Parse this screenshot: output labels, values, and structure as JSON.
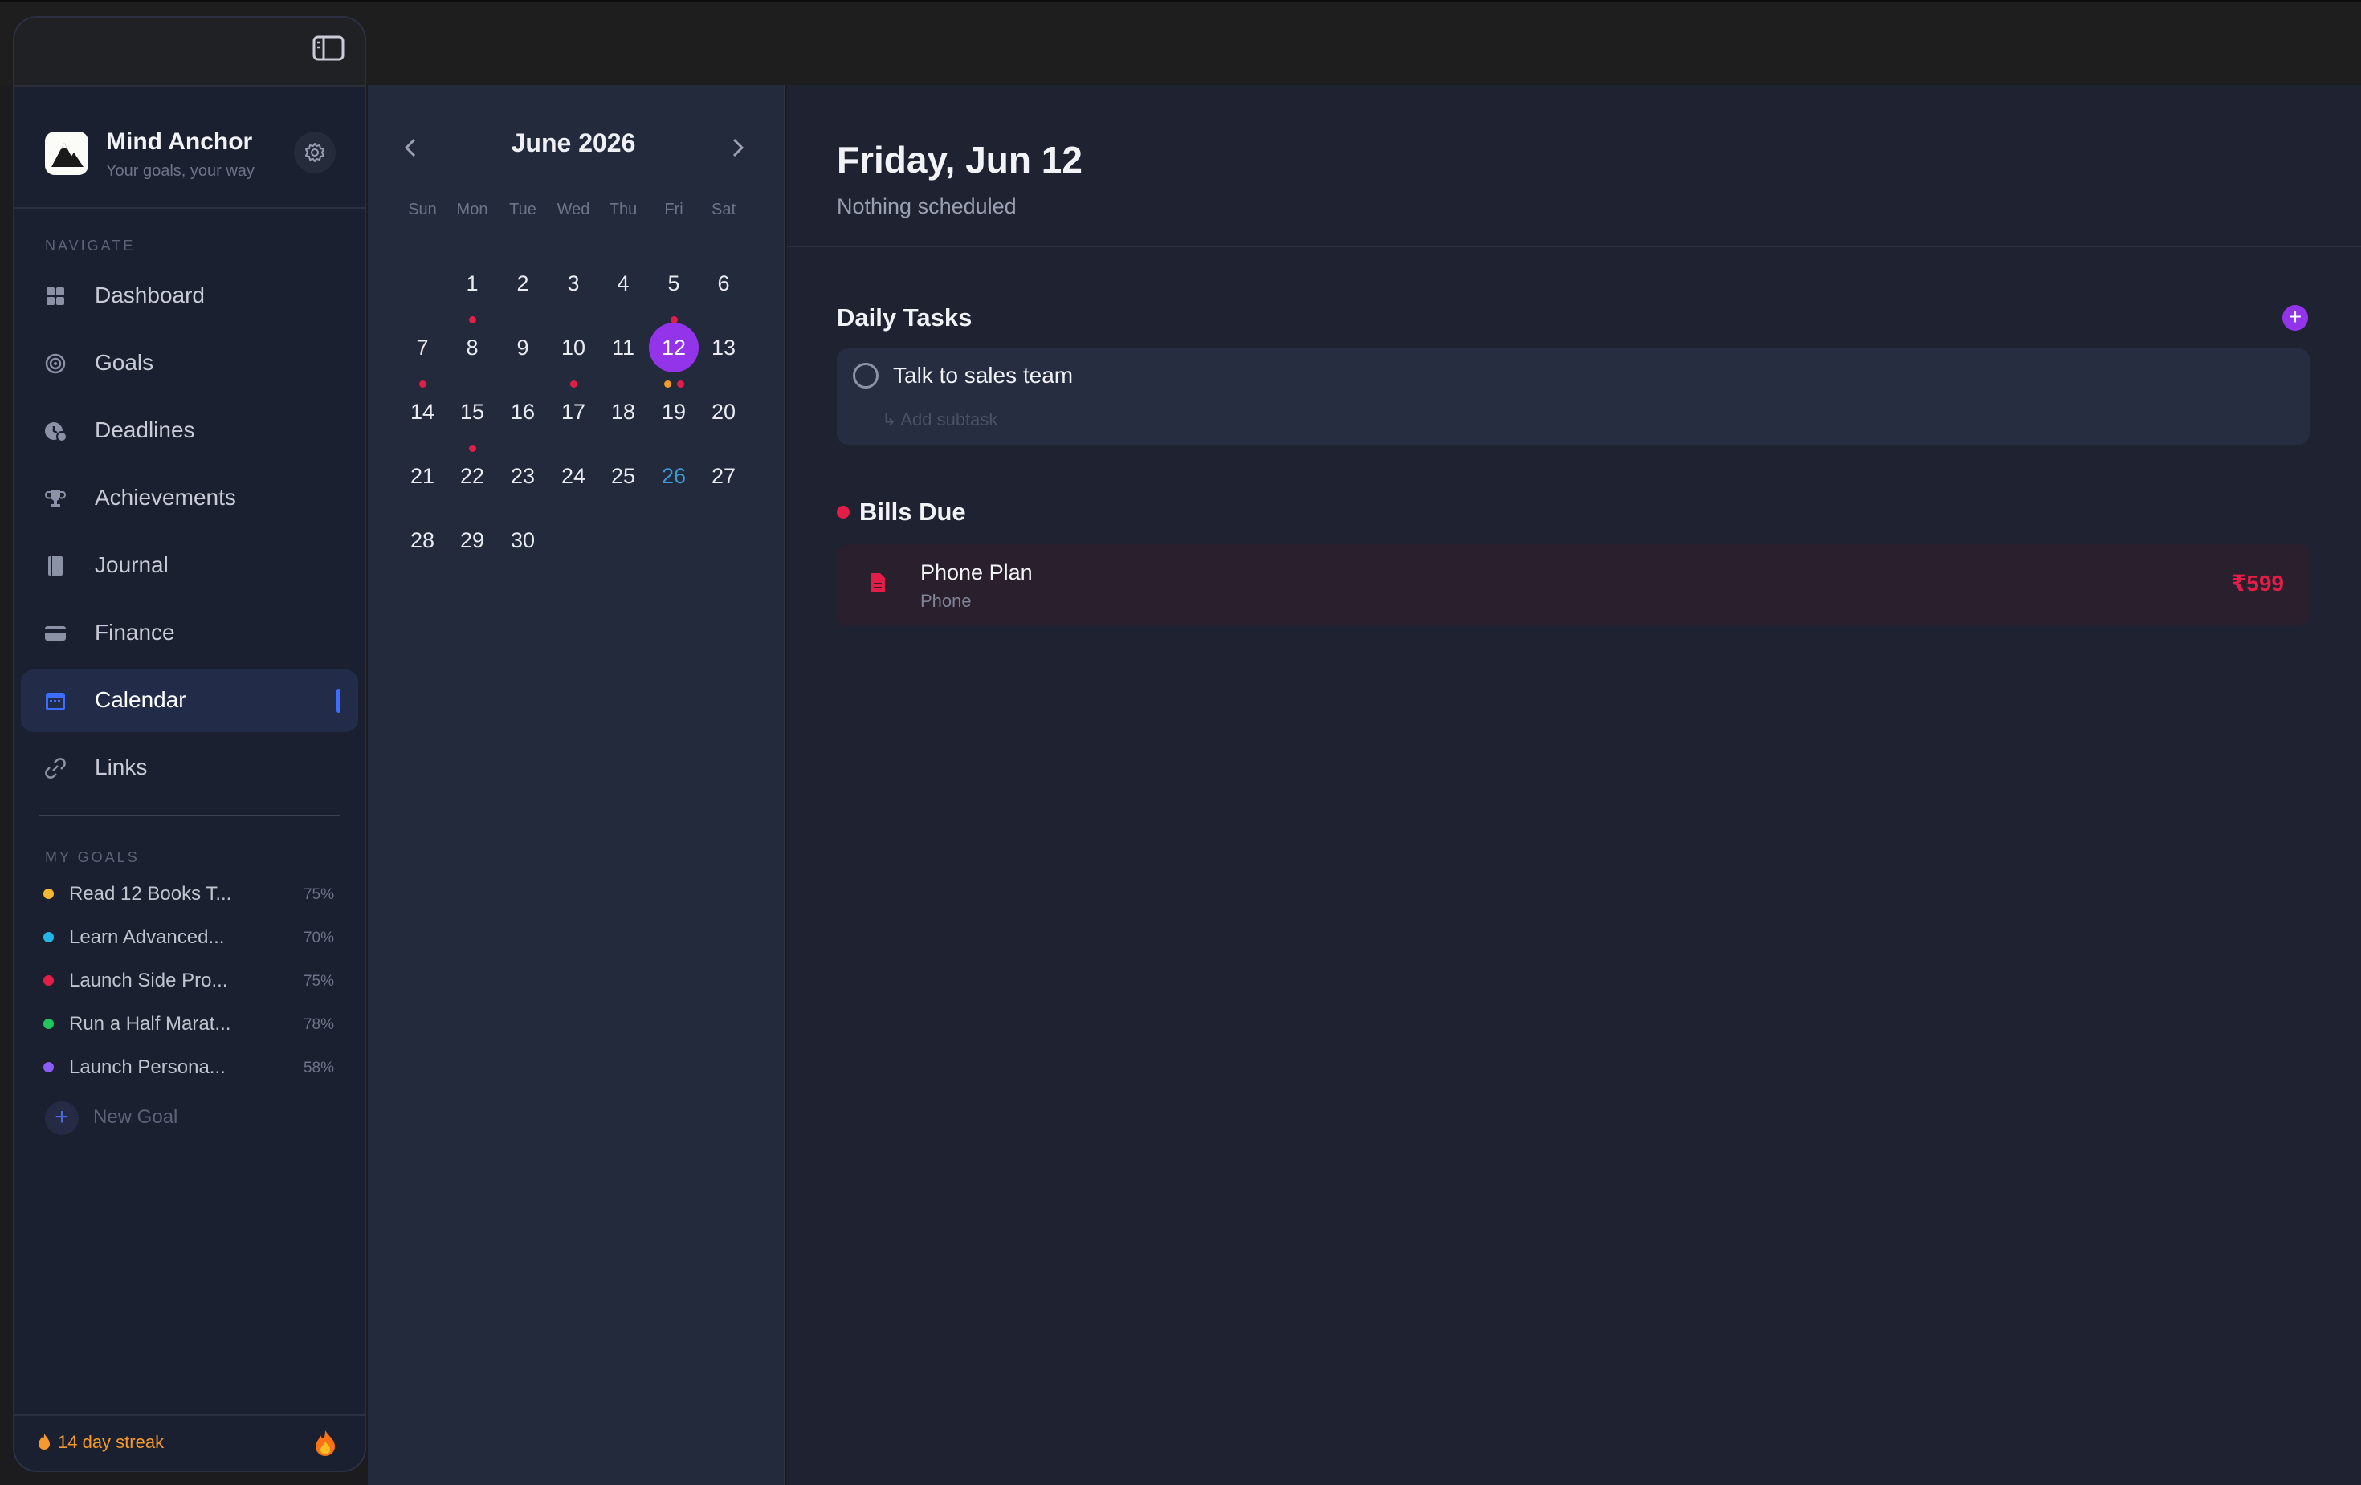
{
  "brand": {
    "name": "Mind Anchor",
    "tagline": "Your goals, your way"
  },
  "nav": {
    "section_label": "NAVIGATE",
    "items": [
      {
        "label": "Dashboard",
        "icon": "grid-icon"
      },
      {
        "label": "Goals",
        "icon": "target-icon"
      },
      {
        "label": "Deadlines",
        "icon": "clock-alert-icon"
      },
      {
        "label": "Achievements",
        "icon": "trophy-icon"
      },
      {
        "label": "Journal",
        "icon": "book-icon"
      },
      {
        "label": "Finance",
        "icon": "card-icon"
      },
      {
        "label": "Calendar",
        "icon": "calendar-icon",
        "active": true
      },
      {
        "label": "Links",
        "icon": "link-icon"
      }
    ]
  },
  "goals": {
    "section_label": "MY GOALS",
    "items": [
      {
        "label": "Read 12 Books T...",
        "pct": "75%",
        "color": "#f5b82e"
      },
      {
        "label": "Learn Advanced...",
        "pct": "70%",
        "color": "#22b8e6"
      },
      {
        "label": "Launch Side Pro...",
        "pct": "75%",
        "color": "#e11d48"
      },
      {
        "label": "Run a Half Marat...",
        "pct": "78%",
        "color": "#22c55e"
      },
      {
        "label": "Launch Persona...",
        "pct": "58%",
        "color": "#8b5cf6"
      }
    ],
    "new_goal_label": "New Goal"
  },
  "streak": {
    "label": "14 day streak"
  },
  "calendar": {
    "month_title": "June 2026",
    "weekdays": [
      "Sun",
      "Mon",
      "Tue",
      "Wed",
      "Thu",
      "Fri",
      "Sat"
    ],
    "first_weekday_index": 1,
    "days_in_month": 30,
    "selected_day": 12,
    "highlight_day": 26,
    "event_dots": {
      "1": [
        "#e11d48"
      ],
      "5": [
        "#e11d48"
      ],
      "7": [
        "#e11d48"
      ],
      "10": [
        "#e11d48"
      ],
      "12": [
        "#f59a2a",
        "#e11d48"
      ],
      "15": [
        "#e11d48"
      ]
    }
  },
  "day_view": {
    "title": "Friday, Jun 12",
    "subtitle": "Nothing scheduled",
    "tasks_heading": "Daily Tasks",
    "tasks": [
      {
        "label": "Talk to sales team",
        "subtask_placeholder": "Add subtask"
      }
    ],
    "bills_heading": "Bills Due",
    "bills": [
      {
        "name": "Phone Plan",
        "category": "Phone",
        "amount": "₹599"
      }
    ]
  },
  "colors": {
    "accent": "#9333ea",
    "active_nav": "#3d6dff",
    "bill": "#e11d48",
    "streak": "#f59a2a"
  }
}
